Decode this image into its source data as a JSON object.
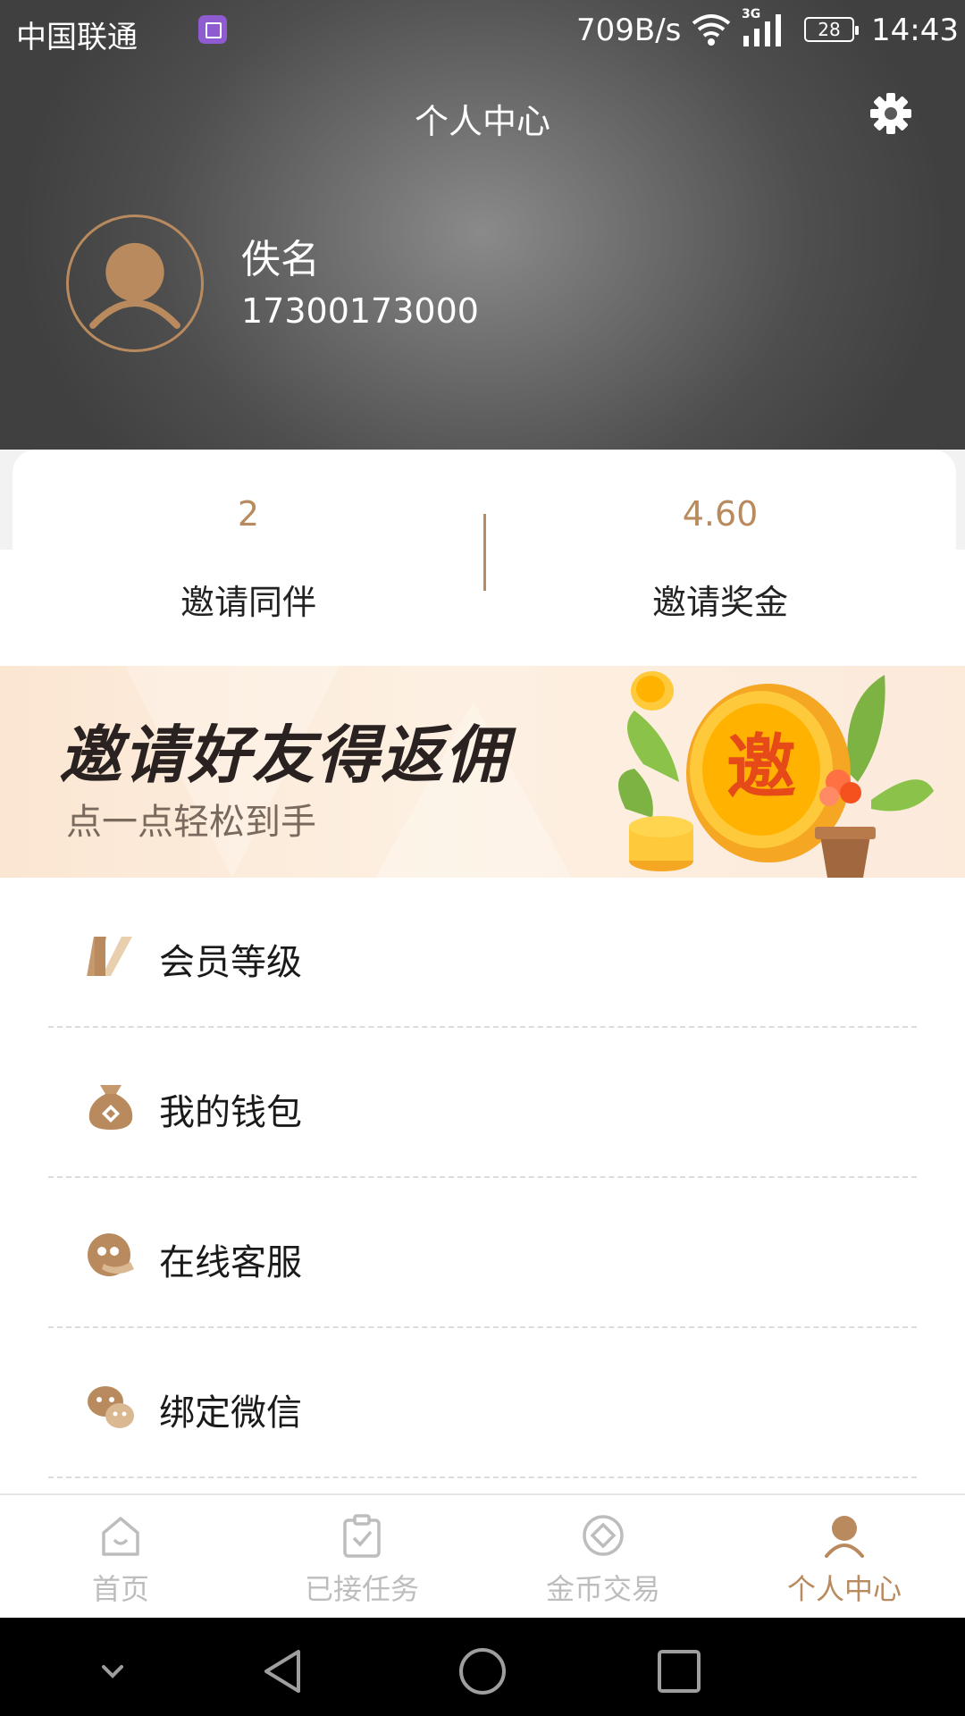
{
  "status_bar": {
    "carrier": "中国联通",
    "net_speed": "709B/s",
    "network_type": "3G",
    "battery": "28",
    "time": "14:43"
  },
  "header": {
    "title": "个人中心",
    "settings_icon": "gear-icon"
  },
  "profile": {
    "name": "佚名",
    "phone": "17300173000"
  },
  "stats": [
    {
      "value": "2",
      "label": "邀请同伴"
    },
    {
      "value": "4.60",
      "label": "邀请奖金"
    }
  ],
  "banner": {
    "title": "邀请好友得返佣",
    "subtitle": "点一点轻松到手",
    "coin_text": "邀"
  },
  "menu": [
    {
      "label": "会员等级",
      "icon": "vip-v-icon"
    },
    {
      "label": "我的钱包",
      "icon": "money-bag-icon"
    },
    {
      "label": "在线客服",
      "icon": "customer-service-icon"
    },
    {
      "label": "绑定微信",
      "icon": "wechat-icon"
    }
  ],
  "tabs": [
    {
      "label": "首页",
      "icon": "home-icon",
      "active": false
    },
    {
      "label": "已接任务",
      "icon": "clipboard-check-icon",
      "active": false
    },
    {
      "label": "金币交易",
      "icon": "coin-exchange-icon",
      "active": false
    },
    {
      "label": "个人中心",
      "icon": "person-icon",
      "active": true
    }
  ],
  "colors": {
    "accent": "#b88a5e",
    "inactive_tab": "#bdbdbd",
    "header_dark": "#404040"
  }
}
